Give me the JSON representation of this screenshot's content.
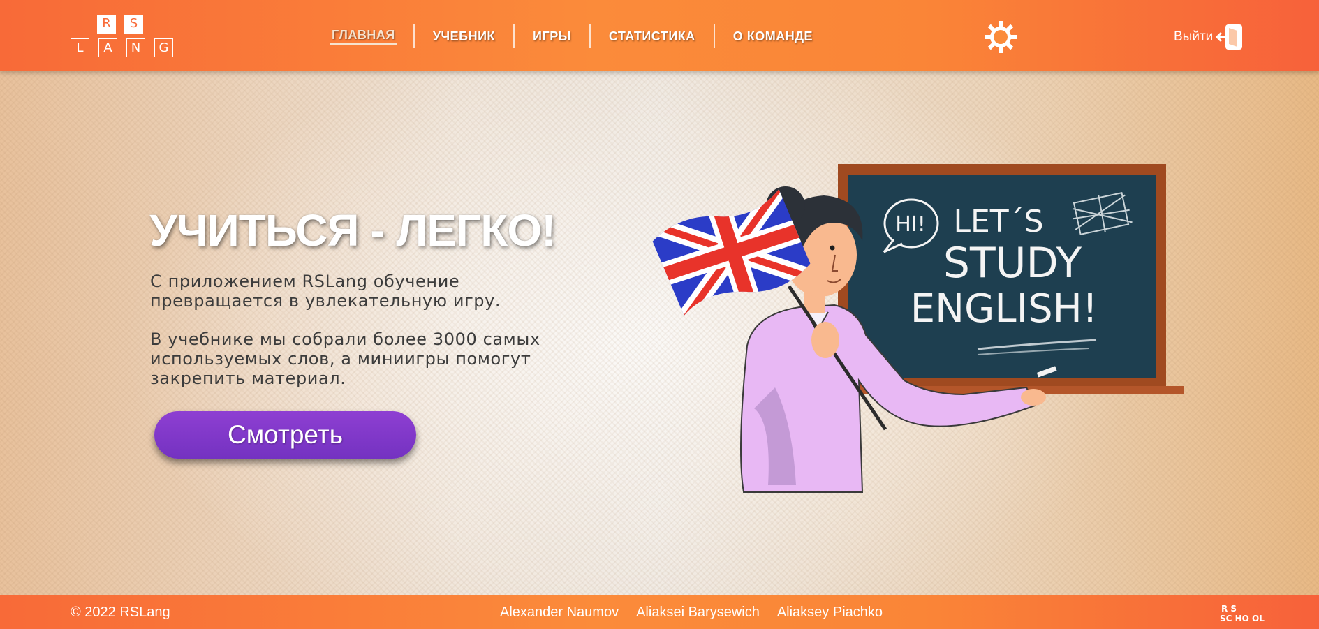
{
  "logo": {
    "letters_top": [
      "R",
      "S"
    ],
    "letters_bottom": [
      "L",
      "A",
      "N",
      "G"
    ]
  },
  "nav": {
    "items": [
      {
        "label": "ГЛАВНАЯ",
        "active": true
      },
      {
        "label": "УЧЕБНИК"
      },
      {
        "label": "ИГРЫ"
      },
      {
        "label": "СТАТИСТИКА"
      },
      {
        "label": "О КОМАНДЕ"
      }
    ]
  },
  "header": {
    "theme_icon": "sun-icon",
    "logout_label": "Выйти",
    "logout_icon": "logout-door-icon"
  },
  "hero": {
    "title": "УЧИТЬСЯ - ЛЕГКО!",
    "paragraph1": "С приложением RSLang обучение превращается в увлекательную игру.",
    "paragraph2": "В учебнике мы собрали более 3000 самых используемых слов, а миниигры помогут закрепить материал.",
    "button_label": "Смотреть"
  },
  "illustration": {
    "bubble": "HI!",
    "board_line1": "LET´S",
    "board_line2": "STUDY",
    "board_line3": "ENGLISH!"
  },
  "footer": {
    "copyright": "© 2022 RSLang",
    "authors": [
      "Alexander Naumov",
      "Aliaksei Barysewich",
      "Aliaksey Piachko"
    ],
    "school_logo_top": "R S",
    "school_logo_bottom": "SC HO OL"
  },
  "colors": {
    "accent": "#f86a38",
    "button": "#7c37c8",
    "board": "#1e3f50",
    "frame": "#a04a20"
  }
}
